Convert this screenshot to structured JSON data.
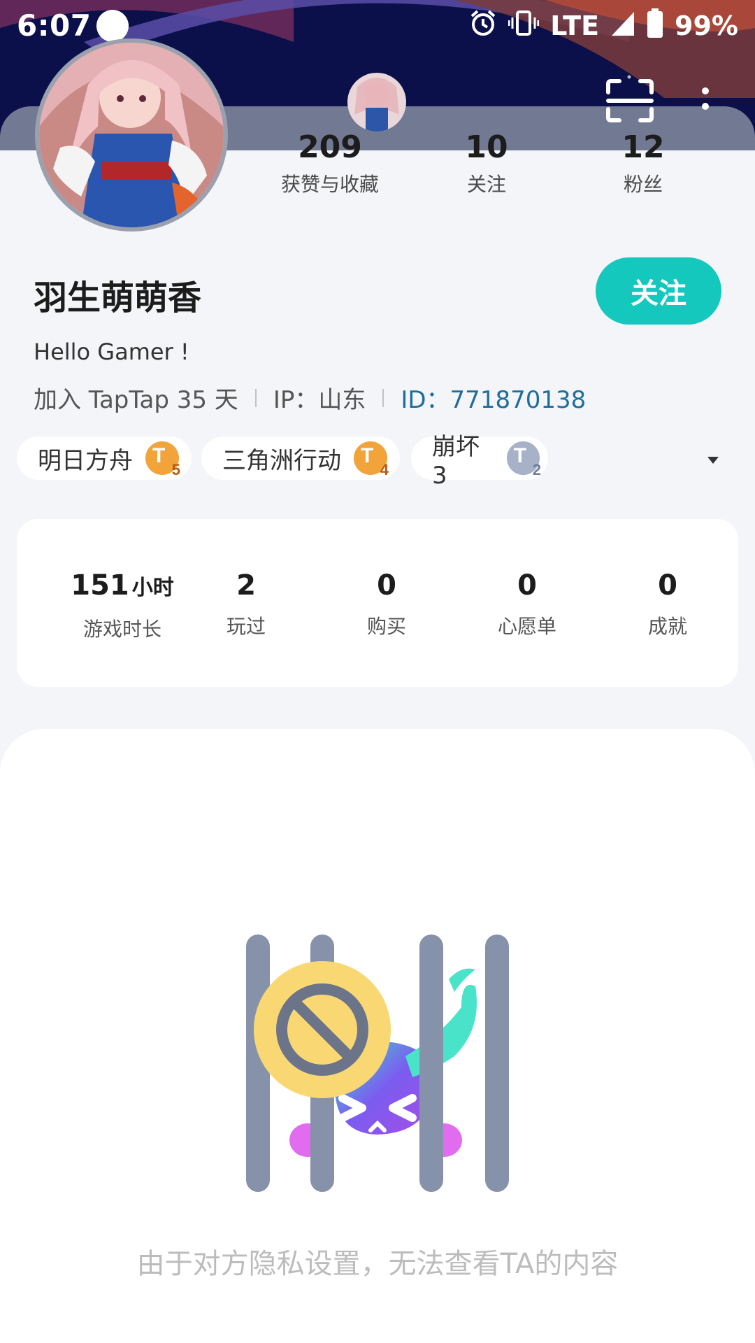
{
  "status_bar": {
    "time": "6:07",
    "network": "LTE",
    "battery": "99%",
    "icons": [
      "alarm-icon",
      "vibrate-icon",
      "signal-icon",
      "battery-icon"
    ]
  },
  "header": {
    "back_icon": "back-chevron-icon",
    "scan_icon": "scan-icon",
    "more_icon": "more-vertical-icon"
  },
  "profile": {
    "username": "羽生萌萌香",
    "follow_label": "关注",
    "bio": "Hello Gamer !",
    "joined": "加入 TapTap 35 天",
    "ip": "IP：山东",
    "id": "ID：771870138"
  },
  "stats": [
    {
      "value": "209",
      "label": "获赞与收藏"
    },
    {
      "value": "10",
      "label": "关注"
    },
    {
      "value": "12",
      "label": "粉丝"
    }
  ],
  "game_tags": [
    {
      "name": "明日方舟",
      "level": "5",
      "badge_color": "#f2a33a"
    },
    {
      "name": "三角洲行动",
      "level": "4",
      "badge_color": "#f2a33a"
    },
    {
      "name": "崩坏3",
      "level": "2",
      "badge_color": "#a7b2c8"
    }
  ],
  "game_stats": {
    "playtime": {
      "value": "151",
      "unit": "小时",
      "label": "游戏时长"
    },
    "items": [
      {
        "value": "2",
        "label": "玩过"
      },
      {
        "value": "0",
        "label": "购买"
      },
      {
        "value": "0",
        "label": "心愿单"
      },
      {
        "value": "0",
        "label": "成就"
      }
    ]
  },
  "privacy": {
    "message": "由于对方隐私设置，无法查看TA的内容"
  },
  "colors": {
    "accent": "#14c8be",
    "id_link": "#1f6d9c",
    "background": "#f4f5f8"
  }
}
